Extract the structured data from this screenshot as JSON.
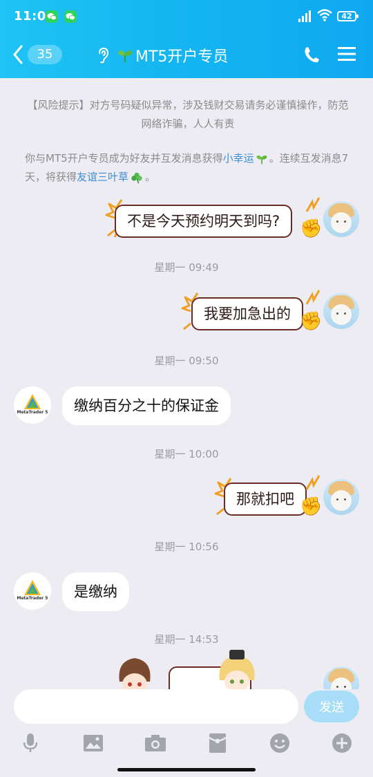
{
  "status_bar": {
    "time": "11:00",
    "battery": "42"
  },
  "header": {
    "unread_count": "35",
    "title": "MT5开户专员",
    "accent": "#14b6f2"
  },
  "notices": {
    "risk": "【风险提示】对方号码疑似异常，涉及钱财交易请务必谨慎操作，防范网络诈骗，人人有责",
    "friend_prefix": "你与MT5开户专员成为好友并互发消息获得",
    "friend_link1": "小幸运",
    "friend_mid": "。连续互发消息7天，将获得",
    "friend_link2": "友谊三叶草",
    "friend_suffix": "。"
  },
  "messages": [
    {
      "side": "right",
      "text": "不是今天预约明天到吗?"
    },
    {
      "type": "timestamp",
      "text": "星期一 09:49"
    },
    {
      "side": "right",
      "text": "我要加急出的"
    },
    {
      "type": "timestamp",
      "text": "星期一 09:50"
    },
    {
      "side": "left",
      "text": "缴纳百分之十的保证金"
    },
    {
      "type": "timestamp",
      "text": "星期一 10:00"
    },
    {
      "side": "right",
      "text": "那就扣吧"
    },
    {
      "type": "timestamp",
      "text": "星期一 10:56"
    },
    {
      "side": "left",
      "text": "是缴纳"
    },
    {
      "type": "timestamp",
      "text": "星期一 14:53"
    }
  ],
  "contact_avatar_label": "MetaTrader 5",
  "input": {
    "placeholder": "",
    "send_label": "发送"
  },
  "toolbar": [
    "microphone-icon",
    "image-icon",
    "camera-icon",
    "red-packet-icon",
    "emoji-icon",
    "plus-icon"
  ]
}
